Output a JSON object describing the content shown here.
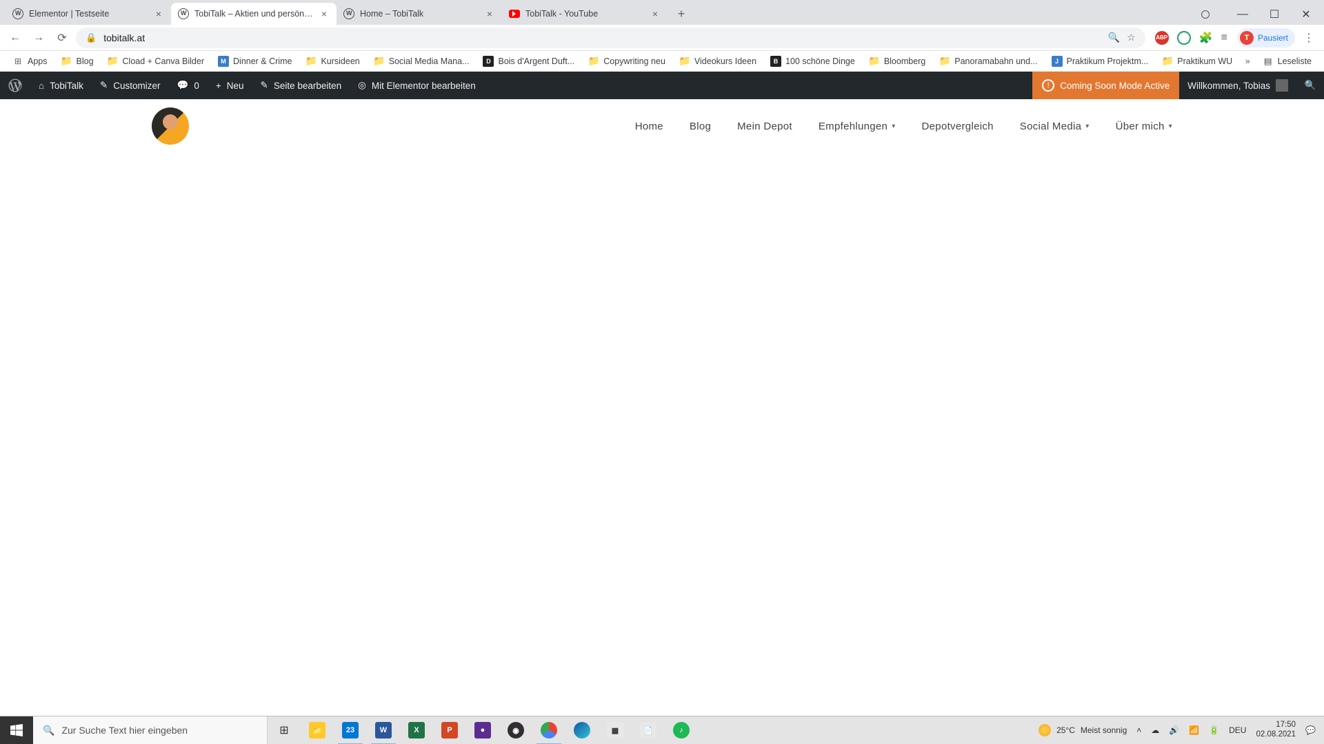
{
  "browser": {
    "tabs": [
      {
        "title": "Elementor | Testseite",
        "icon": "wp"
      },
      {
        "title": "TobiTalk – Aktien und persönlich...",
        "icon": "wp",
        "active": true
      },
      {
        "title": "Home – TobiTalk",
        "icon": "wp"
      },
      {
        "title": "TobiTalk - YouTube",
        "icon": "yt"
      }
    ],
    "url": "tobitalk.at",
    "profile_label": "Pausiert",
    "profile_initial": "T"
  },
  "bookmarks": {
    "apps": "Apps",
    "items": [
      {
        "label": "Blog",
        "icon": "folder"
      },
      {
        "label": "Cload + Canva Bilder",
        "icon": "folder"
      },
      {
        "label": "Dinner & Crime",
        "icon": "sq"
      },
      {
        "label": "Kursideen",
        "icon": "folder"
      },
      {
        "label": "Social Media Mana...",
        "icon": "folder"
      },
      {
        "label": "Bois d'Argent Duft...",
        "icon": "dark"
      },
      {
        "label": "Copywriting neu",
        "icon": "folder"
      },
      {
        "label": "Videokurs Ideen",
        "icon": "folder"
      },
      {
        "label": "100 schöne Dinge",
        "icon": "dark"
      },
      {
        "label": "Bloomberg",
        "icon": "folder"
      },
      {
        "label": "Panoramabahn und...",
        "icon": "folder"
      },
      {
        "label": "Praktikum Projektm...",
        "icon": "sq"
      },
      {
        "label": "Praktikum WU",
        "icon": "folder"
      }
    ],
    "reading_list": "Leseliste"
  },
  "wpbar": {
    "site": "TobiTalk",
    "customizer": "Customizer",
    "comments": "0",
    "new": "Neu",
    "edit": "Seite bearbeiten",
    "elementor": "Mit Elementor bearbeiten",
    "coming": "Coming Soon Mode Active",
    "welcome": "Willkommen, Tobias"
  },
  "nav": {
    "items": [
      {
        "label": "Home"
      },
      {
        "label": "Blog"
      },
      {
        "label": "Mein Depot"
      },
      {
        "label": "Empfehlungen",
        "dropdown": true
      },
      {
        "label": "Depotvergleich"
      },
      {
        "label": "Social Media",
        "dropdown": true
      },
      {
        "label": "Über mich",
        "dropdown": true
      }
    ]
  },
  "taskbar": {
    "search_placeholder": "Zur Suche Text hier eingeben",
    "weather_temp": "25°C",
    "weather_desc": "Meist sonnig",
    "lang": "DEU",
    "time": "17:50",
    "date": "02.08.2021"
  }
}
